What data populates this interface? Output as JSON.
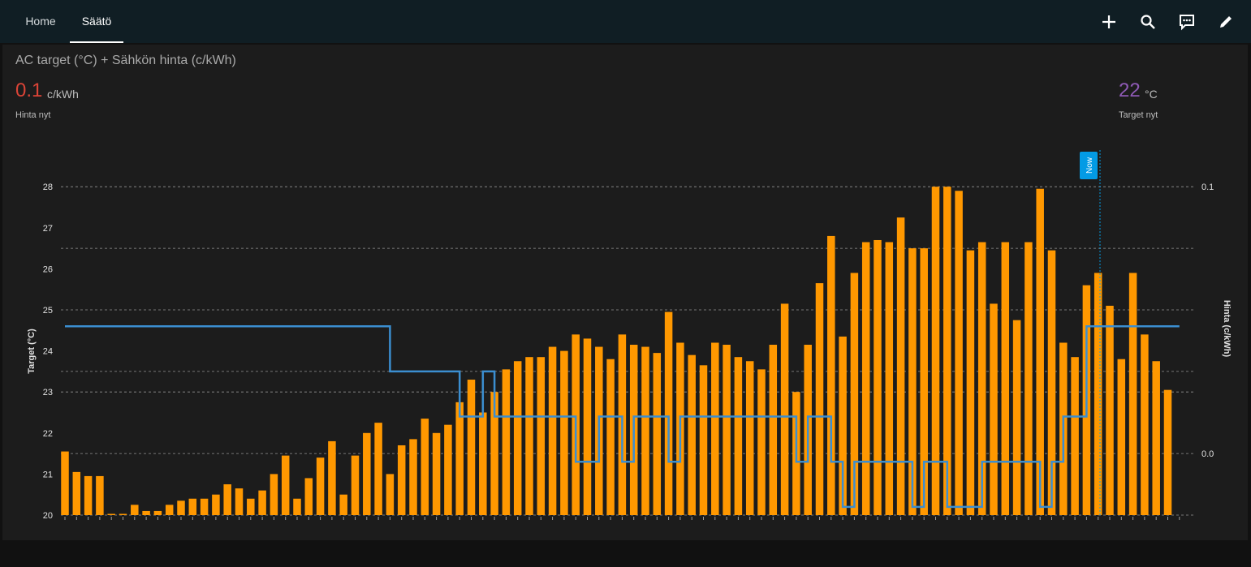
{
  "topbar": {
    "tabs": [
      {
        "label": "Home",
        "active": false
      },
      {
        "label": "Säätö",
        "active": true
      }
    ],
    "actions": [
      {
        "icon": "plus-icon"
      },
      {
        "icon": "search-icon"
      },
      {
        "icon": "assist-chat-icon"
      },
      {
        "icon": "pencil-edit-icon"
      }
    ]
  },
  "card": {
    "title": "AC target (°C) + Sähkön hinta (c/kWh)",
    "stats": {
      "price_now": {
        "value": "0.1",
        "unit": "c/kWh",
        "label": "Hinta nyt",
        "color": "#db4437"
      },
      "target_now": {
        "value": "22",
        "unit": "°C",
        "label": "Target nyt",
        "color": "#8e5ab5"
      }
    }
  },
  "chart_data": {
    "type": "bar",
    "left_axis": {
      "label": "Target (°C)",
      "ticks": [
        "20",
        "21",
        "22",
        "23",
        "24",
        "25",
        "26",
        "27",
        "28"
      ]
    },
    "right_axis": {
      "label": "Hinta (c/kWh)",
      "ticks": [
        "0.0",
        "0.1"
      ]
    },
    "now_label": "Now",
    "colors": {
      "bars": "#ff9800",
      "line": "#3b8ed0",
      "now": "#039be5",
      "grid": "#bdbdbd"
    },
    "price_series": {
      "values": [
        21.55,
        21.05,
        20.95,
        20.95,
        20.0,
        20.0,
        20.25,
        20.1,
        20.1,
        20.25,
        20.35,
        20.4,
        20.4,
        20.5,
        20.75,
        20.65,
        20.4,
        20.6,
        21.0,
        21.45,
        20.4,
        20.9,
        21.4,
        21.8,
        20.5,
        21.45,
        22.0,
        22.25,
        21.0,
        21.7,
        21.85,
        22.35,
        22.0,
        22.2,
        22.75,
        23.3,
        22.5,
        23.0,
        23.55,
        23.75,
        23.85,
        23.85,
        24.1,
        24.0,
        24.4,
        24.3,
        24.1,
        23.8,
        24.4,
        24.15,
        24.1,
        23.95,
        24.95,
        24.2,
        23.9,
        23.65,
        24.2,
        24.15,
        23.85,
        23.75,
        23.55,
        24.15,
        25.15,
        23.0,
        24.15,
        25.65,
        26.8,
        24.35,
        25.9,
        26.65,
        26.7,
        26.65,
        27.25,
        26.5,
        26.5,
        28.0,
        28.0,
        27.9,
        26.45,
        26.65,
        25.15,
        26.65,
        24.75,
        26.65,
        27.95,
        26.45,
        24.2,
        23.85,
        25.6,
        25.9,
        25.1,
        23.8,
        25.9,
        24.4,
        23.75,
        23.05
      ]
    },
    "target_series": {
      "values": [
        [
          0,
          24.6
        ],
        [
          28,
          24.6
        ],
        [
          28,
          23.5
        ],
        [
          34,
          23.5
        ],
        [
          34,
          22.4
        ],
        [
          36,
          22.4
        ],
        [
          36,
          23.5
        ],
        [
          37,
          23.5
        ],
        [
          37,
          22.4
        ],
        [
          44,
          22.4
        ],
        [
          44,
          21.3
        ],
        [
          46,
          21.3
        ],
        [
          46,
          22.4
        ],
        [
          48,
          22.4
        ],
        [
          48,
          21.3
        ],
        [
          49,
          21.3
        ],
        [
          49,
          22.4
        ],
        [
          52,
          22.4
        ],
        [
          52,
          21.3
        ],
        [
          53,
          21.3
        ],
        [
          53,
          22.4
        ],
        [
          63,
          22.4
        ],
        [
          63,
          21.3
        ],
        [
          64,
          21.3
        ],
        [
          64,
          22.4
        ],
        [
          66,
          22.4
        ],
        [
          66,
          21.3
        ],
        [
          67,
          21.3
        ],
        [
          67,
          20.2
        ],
        [
          68,
          20.2
        ],
        [
          68,
          21.3
        ],
        [
          73,
          21.3
        ],
        [
          73,
          20.2
        ],
        [
          74,
          20.2
        ],
        [
          74,
          21.3
        ],
        [
          76,
          21.3
        ],
        [
          76,
          20.2
        ],
        [
          79,
          20.2
        ],
        [
          79,
          21.3
        ],
        [
          84,
          21.3
        ],
        [
          84,
          20.2
        ],
        [
          85,
          20.2
        ],
        [
          85,
          21.3
        ],
        [
          86,
          21.3
        ],
        [
          86,
          22.4
        ],
        [
          88,
          22.4
        ],
        [
          88,
          24.6
        ],
        [
          96,
          24.6
        ]
      ]
    }
  }
}
